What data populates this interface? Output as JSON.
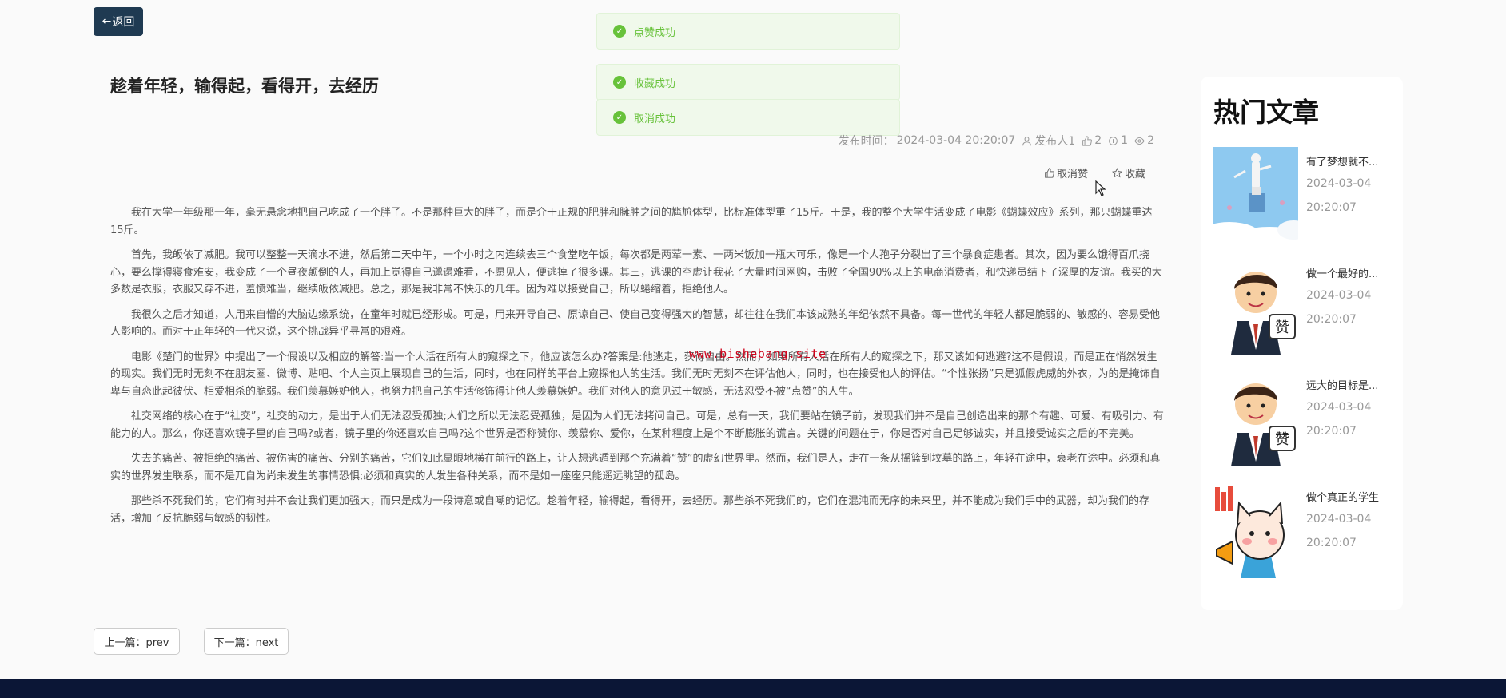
{
  "back": {
    "arrow": "←",
    "label": "返回"
  },
  "toasts": [
    "点赞成功",
    "收藏成功",
    "取消成功"
  ],
  "article": {
    "title": "趁着年轻，输得起，看得开，去经历",
    "publish_label": "发布时间：",
    "publish_time": "2024-03-04 20:20:07",
    "author": "发布人1",
    "likes": "2",
    "collects": "1",
    "views": "2",
    "unlike_label": "取消赞",
    "collect_label": "收藏",
    "paragraphs": [
      "我在大学一年级那一年，毫无悬念地把自己吃成了一个胖子。不是那种巨大的胖子，而是介于正规的肥胖和臃肿之间的尴尬体型，比标准体型重了15斤。于是，我的整个大学生活变成了电影《蝴蝶效应》系列，那只蝴蝶重达15斤。",
      "首先，我皈依了减肥。我可以整整一天滴水不进，然后第二天中午，一个小时之内连续去三个食堂吃午饭，每次都是两荤一素、一两米饭加一瓶大可乐，像是一个人孢子分裂出了三个暴食症患者。其次，因为要么饿得百爪挠心，要么撑得寝食难安，我变成了一个昼夜颠倒的人，再加上觉得自己邋遢难看，不愿见人，便逃掉了很多课。其三，逃课的空虚让我花了大量时间网购，击败了全国90%以上的电商消费者，和快递员结下了深厚的友谊。我买的大多数是衣服，衣服又穿不进，羞愤难当，继续皈依减肥。总之，那是我非常不快乐的几年。因为难以接受自己，所以蜷缩着，拒绝他人。",
      "我很久之后才知道，人用来自憎的大脑边缘系统，在童年时就已经形成。可是，用来开导自己、原谅自己、使自己变得强大的智慧，却往往在我们本该成熟的年纪依然不具备。每一世代的年轻人都是脆弱的、敏感的、容易受他人影响的。而对于正年轻的一代来说，这个挑战异乎寻常的艰难。",
      "电影《楚门的世界》中提出了一个假设以及相应的解答:当一个人活在所有人的窥探之下，他应该怎么办?答案是:他逃走，获得自由。然而，如果所有人活在所有人的窥探之下，那又该如何逃避?这不是假设，而是正在悄然发生的现实。我们无时无刻不在朋友圈、微博、贴吧、个人主页上展现自己的生活，同时，也在同样的平台上窥探他人的生活。我们无时无刻不在评估他人，同时，也在接受他人的评估。“个性张扬”只是狐假虎威的外衣，为的是掩饰自卑与自恋此起彼伏、相爱相杀的脆弱。我们羡慕嫉妒他人，也努力把自己的生活修饰得让他人羡慕嫉妒。我们对他人的意见过于敏感，无法忍受不被“点赞”的人生。",
      "社交网络的核心在于“社交”，社交的动力，是出于人们无法忍受孤独;人们之所以无法忍受孤独，是因为人们无法拷问自己。可是，总有一天，我们要站在镜子前，发现我们并不是自己创造出来的那个有趣、可爱、有吸引力、有能力的人。那么，你还喜欢镜子里的自己吗?或者，镜子里的你还喜欢自己吗?这个世界是否称赞你、羡慕你、爱你，在某种程度上是个不断膨胀的谎言。关键的问题在于，你是否对自己足够诚实，并且接受诚实之后的不完美。",
      "失去的痛苦、被拒绝的痛苦、被伤害的痛苦、分别的痛苦，它们如此显眼地横在前行的路上，让人想逃遁到那个充满着“赞”的虚幻世界里。然而，我们是人，走在一条从摇篮到坟墓的路上，年轻在途中，衰老在途中。必须和真实的世界发生联系，而不是兀自为尚未发生的事情恐惧;必须和真实的人发生各种关系，而不是如一座座只能遥远眺望的孤岛。",
      "那些杀不死我们的，它们有时并不会让我们更加强大，而只是成为一段诗意或自嘲的记忆。趁着年轻，输得起，看得开，去经历。那些杀不死我们的，它们在混沌而无序的未来里，并不能成为我们手中的武器，却为我们的存活，增加了反抗脆弱与敏感的韧性。"
    ]
  },
  "watermark": "www.bishebang.site",
  "sidebar": {
    "title": "热门文章",
    "items": [
      {
        "title": "有了梦想就不...",
        "date": "2024-03-04",
        "time": "20:20:07"
      },
      {
        "title": "做一个最好的...",
        "date": "2024-03-04",
        "time": "20:20:07"
      },
      {
        "title": "远大的目标是...",
        "date": "2024-03-04",
        "time": "20:20:07"
      },
      {
        "title": "做个真正的学生",
        "date": "2024-03-04",
        "time": "20:20:07"
      }
    ]
  },
  "nav": {
    "prev": "上一篇：prev",
    "next": "下一篇：next"
  },
  "colors": {
    "success": "#67c23a",
    "back_bg": "#1f3a52",
    "footer": "#0b1636",
    "watermark": "#d0021b"
  }
}
